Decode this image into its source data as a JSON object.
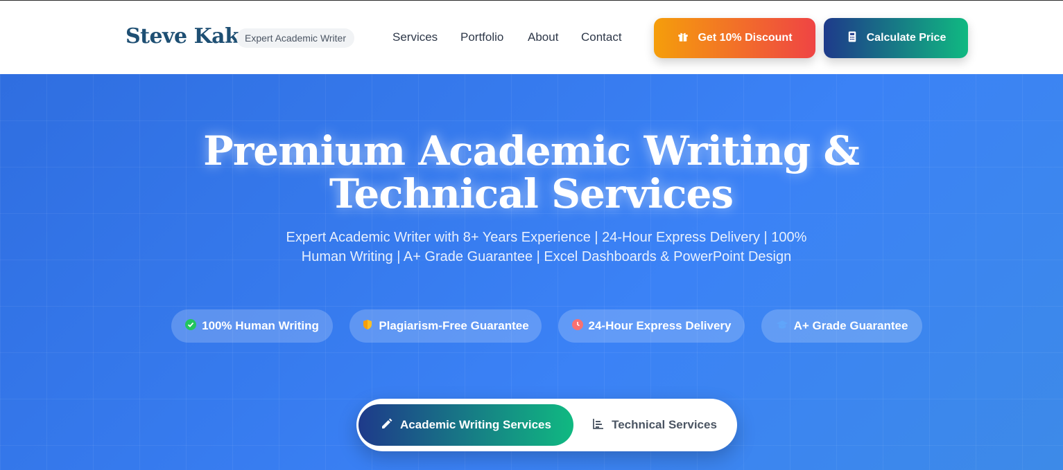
{
  "header": {
    "brand": "Steve Kaks",
    "tagline": "Expert Academic Writer",
    "nav": [
      "Services",
      "Portfolio",
      "About",
      "Contact"
    ],
    "discount_button": "Get 10% Discount",
    "calculate_button": "Calculate Price"
  },
  "hero": {
    "title": "Premium Academic Writing & Technical Services",
    "subtitle": "Expert Academic Writer with 8+ Years Experience | 24-Hour Express Delivery | 100% Human Writing | A+ Grade Guarantee | Excel Dashboards & PowerPoint Design",
    "badges": [
      {
        "label": "100% Human Writing",
        "icon": "check-circle-icon",
        "color": "#22c55e"
      },
      {
        "label": "Plagiarism-Free Guarantee",
        "icon": "shield-icon",
        "color": "#fbbf24"
      },
      {
        "label": "24-Hour Express Delivery",
        "icon": "clock-icon",
        "color": "#f87171"
      },
      {
        "label": "A+ Grade Guarantee",
        "icon": "graduation-cap-icon",
        "color": "#60a5fa"
      }
    ],
    "tabs": {
      "active": "Academic Writing Services",
      "inactive": "Technical Services"
    }
  },
  "colors": {
    "brand": "#1e4f73",
    "hero_blue": "#3b82f6",
    "discount_gradient": [
      "#f59e0b",
      "#ef4444"
    ],
    "calc_gradient": [
      "#1e3a8a",
      "#10b981"
    ]
  }
}
